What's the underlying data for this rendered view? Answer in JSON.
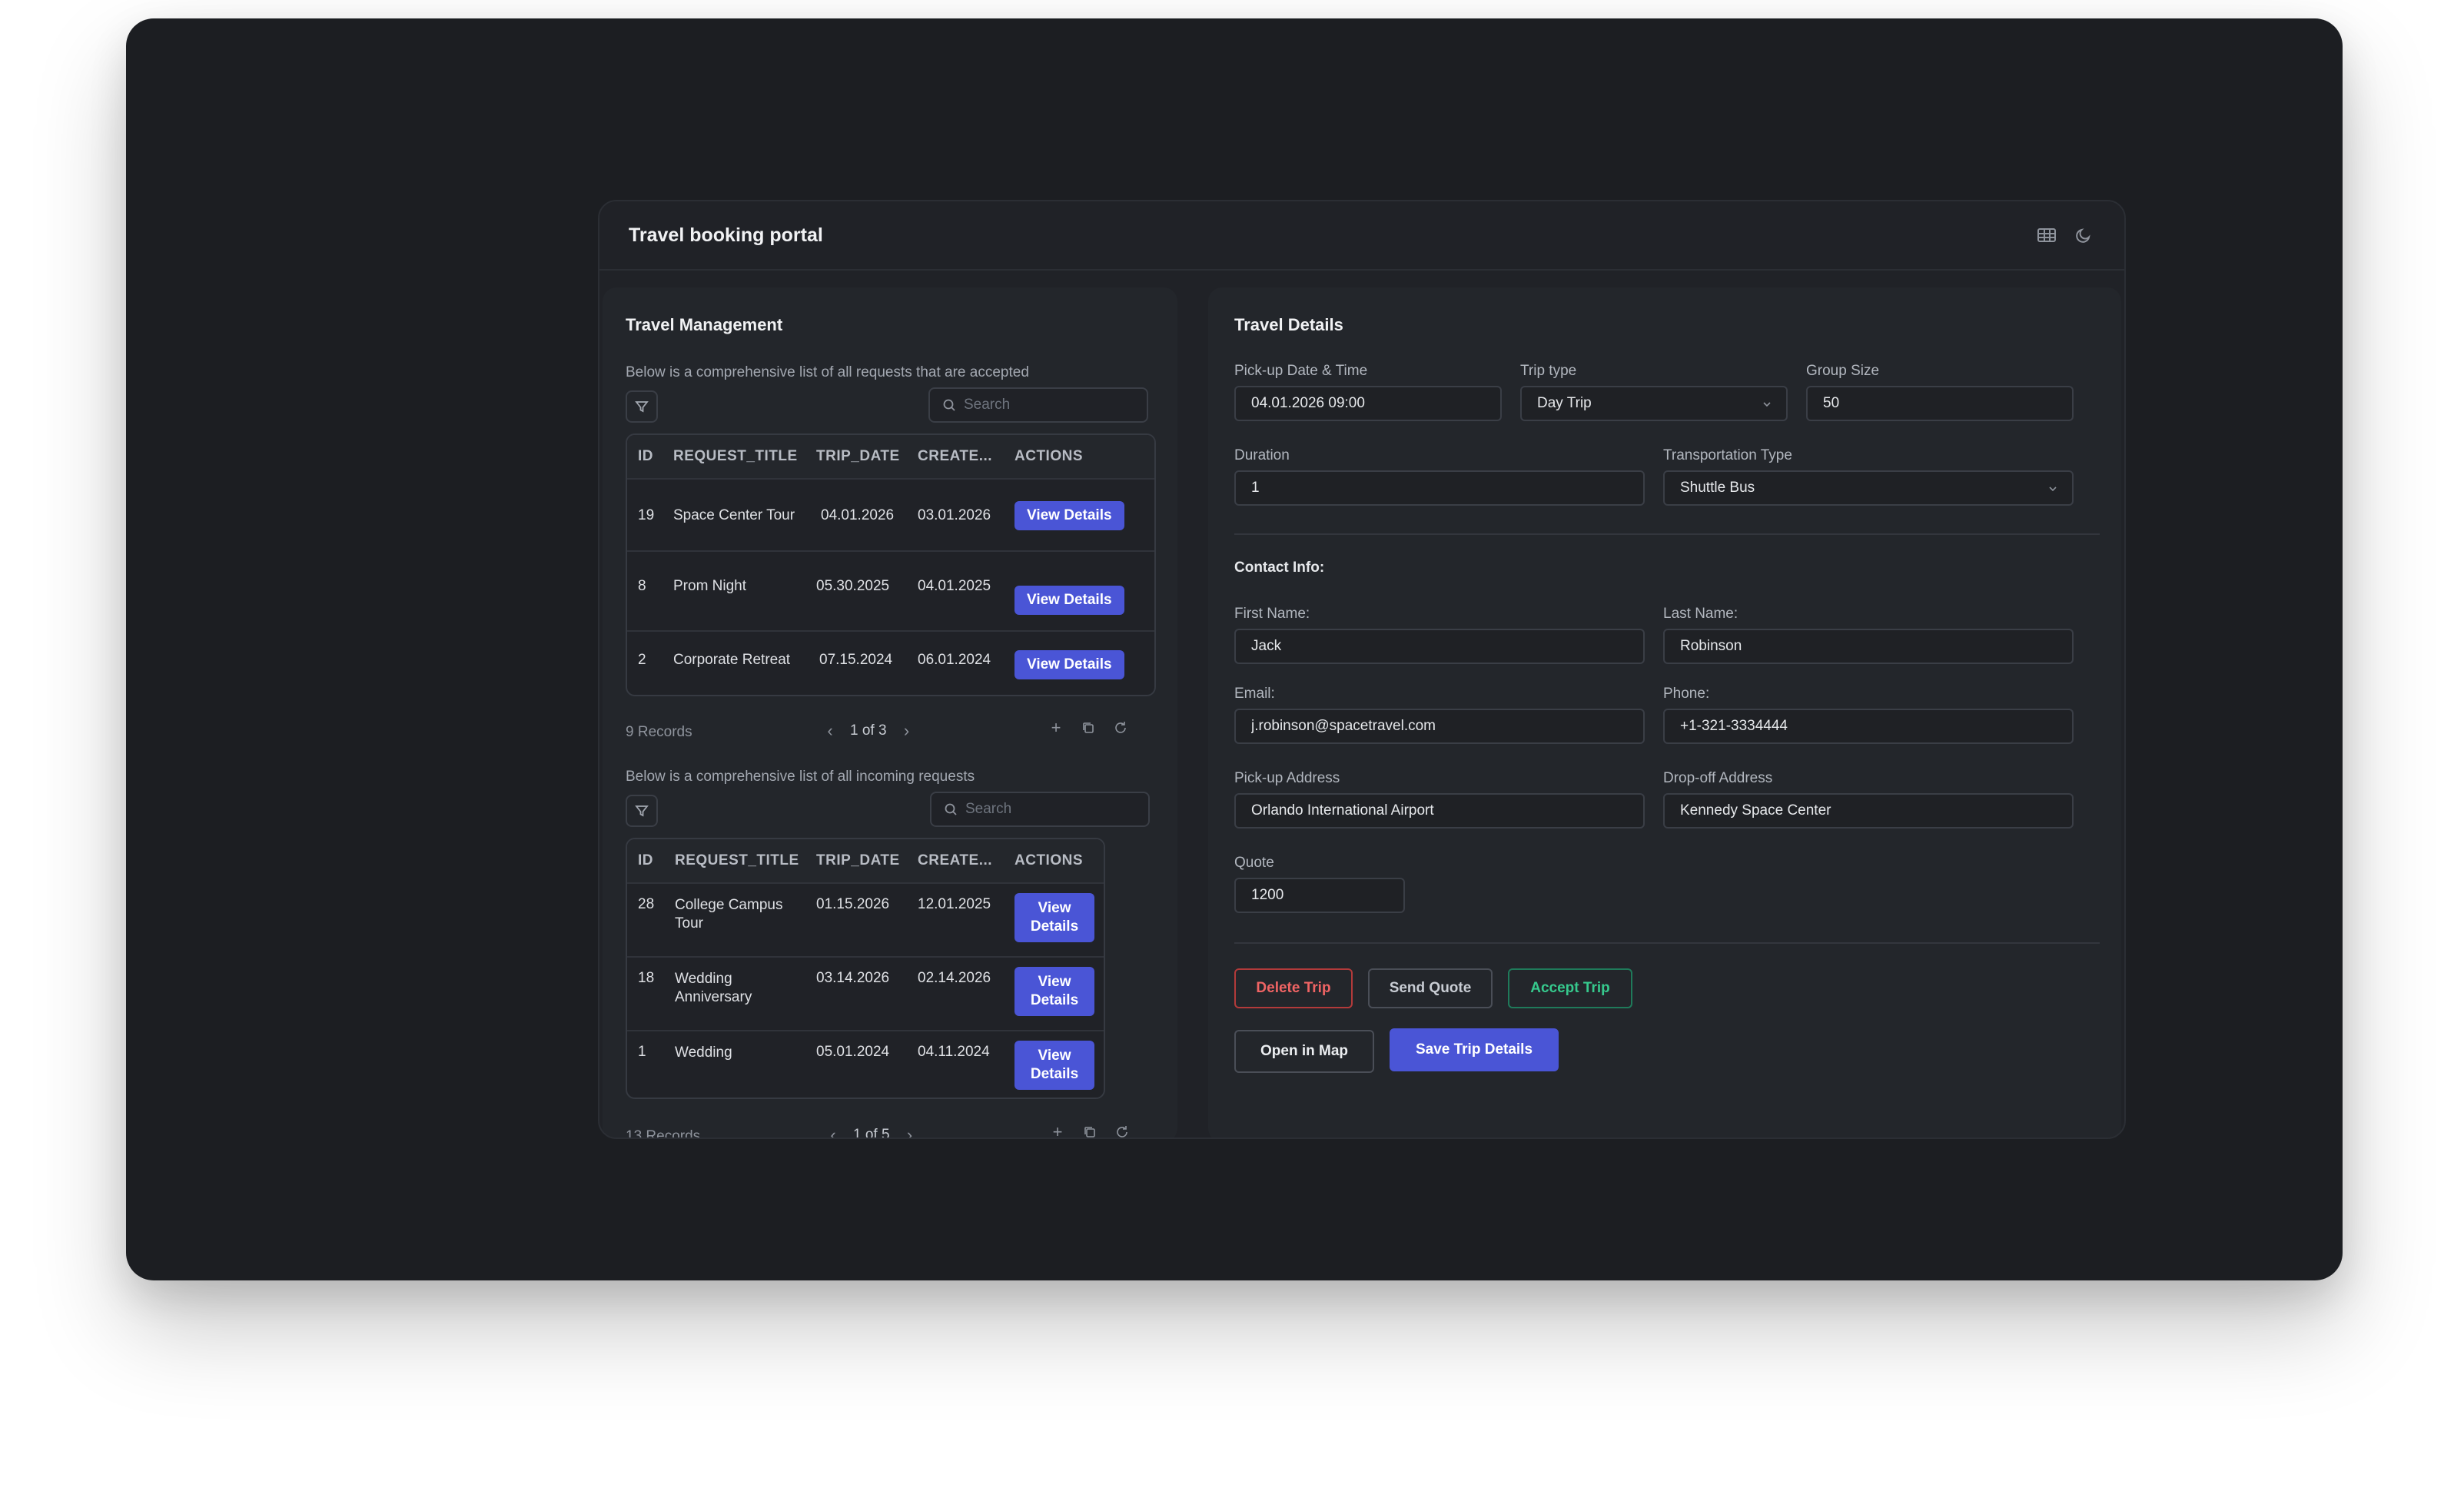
{
  "app": {
    "title": "Travel booking portal"
  },
  "left": {
    "title": "Travel Management",
    "accepted": {
      "description": "Below is a comprehensive list of all requests that are accepted",
      "search_placeholder": "Search",
      "columns": [
        "ID",
        "REQUEST_TITLE",
        "TRIP_DATE",
        "CREATE...",
        "ACTIONS"
      ],
      "rows": [
        {
          "id": "19",
          "title": "Space Center Tour",
          "trip_date": "04.01.2026",
          "created": "03.01.2026",
          "action": "View Details"
        },
        {
          "id": "8",
          "title": "Prom Night",
          "trip_date": "05.30.2025",
          "created": "04.01.2025",
          "action": "View Details"
        },
        {
          "id": "2",
          "title": "Corporate Retreat",
          "trip_date": "07.15.2024",
          "created": "06.01.2024",
          "action": "View Details"
        }
      ],
      "records": "9 Records",
      "page": "1 of 3"
    },
    "incoming": {
      "description": "Below is a comprehensive list of all incoming requests",
      "search_placeholder": "Search",
      "columns": [
        "ID",
        "REQUEST_TITLE",
        "TRIP_DATE",
        "CREATE...",
        "ACTIONS"
      ],
      "rows": [
        {
          "id": "28",
          "title": "College Campus Tour",
          "trip_date": "01.15.2026",
          "created": "12.01.2025",
          "action": "View Details"
        },
        {
          "id": "18",
          "title": "Wedding Anniversary",
          "trip_date": "03.14.2026",
          "created": "02.14.2026",
          "action": "View Details"
        },
        {
          "id": "1",
          "title": "Wedding",
          "trip_date": "05.01.2024",
          "created": "04.11.2024",
          "action": "View Details"
        }
      ],
      "records": "13 Records",
      "page": "1 of 5"
    }
  },
  "details": {
    "title": "Travel Details",
    "pickup_datetime": {
      "label": "Pick-up Date & Time",
      "value": "04.01.2026 09:00"
    },
    "trip_type": {
      "label": "Trip type",
      "value": "Day Trip"
    },
    "group_size": {
      "label": "Group Size",
      "value": "50"
    },
    "duration": {
      "label": "Duration",
      "value": "1"
    },
    "transport_type": {
      "label": "Transportation Type",
      "value": "Shuttle Bus"
    },
    "contact_heading": "Contact Info:",
    "first_name": {
      "label": "First Name:",
      "value": "Jack"
    },
    "last_name": {
      "label": "Last Name:",
      "value": "Robinson"
    },
    "email": {
      "label": "Email:",
      "value": "j.robinson@spacetravel.com"
    },
    "phone": {
      "label": "Phone:",
      "value": "+1-321-3334444"
    },
    "pickup_address": {
      "label": "Pick-up Address",
      "value": "Orlando International Airport"
    },
    "dropoff_address": {
      "label": "Drop-off Address",
      "value": "Kennedy Space Center"
    },
    "quote": {
      "label": "Quote",
      "value": "1200"
    },
    "buttons": {
      "delete": "Delete Trip",
      "send_quote": "Send Quote",
      "accept": "Accept Trip",
      "open_map": "Open in Map",
      "save": "Save Trip Details"
    }
  },
  "colors": {
    "accent": "#4a55d6",
    "danger": "#f06464",
    "success": "#36c98d",
    "background": "#1c1e22"
  },
  "icons": [
    "table-icon",
    "moon-icon",
    "filter-icon",
    "search-icon",
    "chevron-left-icon",
    "chevron-right-icon",
    "plus-icon",
    "copy-icon",
    "refresh-icon",
    "chevron-down-icon"
  ]
}
